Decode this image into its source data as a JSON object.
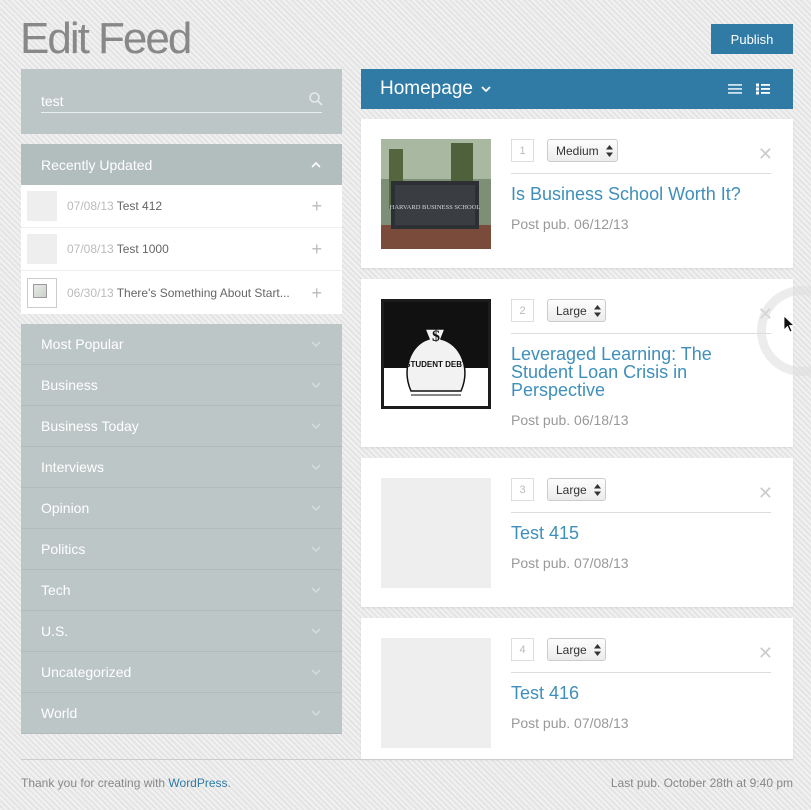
{
  "page": {
    "title": "Edit Feed"
  },
  "toolbar": {
    "publish_label": "Publish"
  },
  "search": {
    "value": "test"
  },
  "recent": {
    "header": "Recently Updated",
    "items": [
      {
        "date": "07/08/13",
        "title": "Test 412"
      },
      {
        "date": "07/08/13",
        "title": "Test 1000"
      },
      {
        "date": "06/30/13",
        "title": "There's Something About Start..."
      }
    ]
  },
  "categories": [
    "Most Popular",
    "Business",
    "Business Today",
    "Interviews",
    "Opinion",
    "Politics",
    "Tech",
    "U.S.",
    "Uncategorized",
    "World"
  ],
  "feed": {
    "name": "Homepage"
  },
  "cards": [
    {
      "number": "1",
      "size": "Medium",
      "title": "Is Business School Worth It?",
      "meta": "Post pub. 06/12/13",
      "thumb_alt": "HARVARD BUSINESS SCHOOL"
    },
    {
      "number": "2",
      "size": "Large",
      "title": "Leveraged Learning: The Student Loan Crisis in Perspective",
      "meta": "Post pub. 06/18/13",
      "thumb_alt": "STUDENT DEBT"
    },
    {
      "number": "3",
      "size": "Large",
      "title": "Test 415",
      "meta": "Post pub. 07/08/13"
    },
    {
      "number": "4",
      "size": "Large",
      "title": "Test 416",
      "meta": "Post pub. 07/08/13"
    }
  ],
  "footer": {
    "thanks_prefix": "Thank you for creating with ",
    "wp_link": "WordPress",
    "thanks_suffix": ".",
    "last_pub": "Last pub. October 28th at 9:40 pm"
  },
  "colors": {
    "accent": "#2f7ba5",
    "panel": "#bcc6c7",
    "link": "#3e8fba"
  }
}
